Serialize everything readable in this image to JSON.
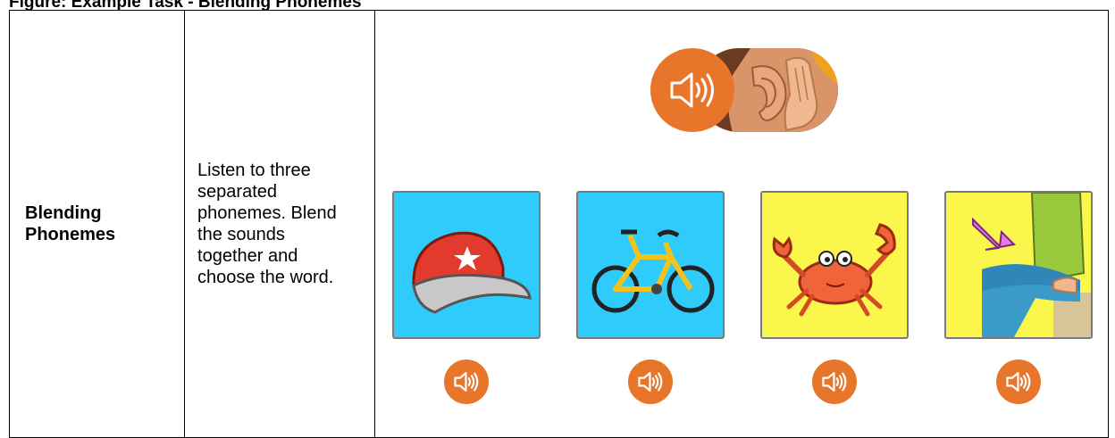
{
  "caption": "Figure: Example Task - Blending Phonemes",
  "task": {
    "name": "Blending Phonemes",
    "instructions": "Listen to three separated phonemes. Blend the sounds together and choose the word."
  },
  "stimulus": {
    "prompt_icons": [
      "speaker-icon",
      "listening-ear-icon"
    ],
    "choices": [
      {
        "picture": "cap",
        "background": "#2ecbfb"
      },
      {
        "picture": "bike",
        "background": "#2ecbfb"
      },
      {
        "picture": "crab",
        "background": "#fbf64c"
      },
      {
        "picture": "lap",
        "background": "#fbf64c"
      }
    ]
  },
  "colors": {
    "speaker_orange": "#e8762a",
    "card_border": "#7a7a7a"
  }
}
